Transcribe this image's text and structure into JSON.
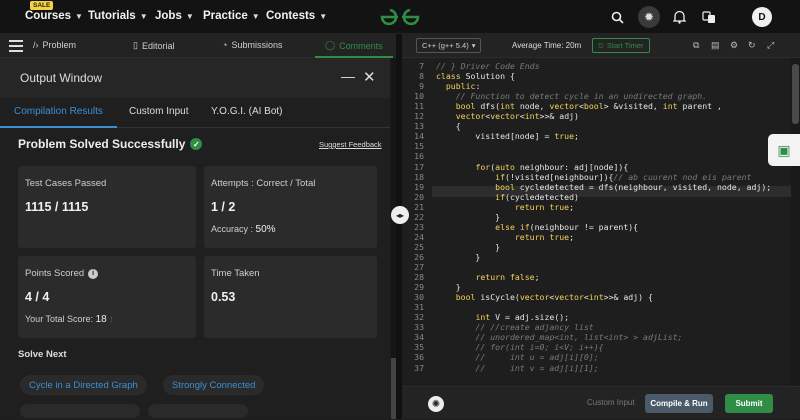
{
  "nav": {
    "sale_badge": "SALE",
    "items": [
      {
        "label": "Courses"
      },
      {
        "label": "Tutorials"
      },
      {
        "label": "Jobs"
      },
      {
        "label": "Practice"
      },
      {
        "label": "Contests"
      }
    ],
    "avatar_initial": "D",
    "brand_color": "#2f8d46"
  },
  "left_tabs": {
    "problem": "Problem",
    "editorial": "Editorial",
    "submissions": "Submissions",
    "comments": "Comments"
  },
  "output_window": {
    "title": "Output Window",
    "tabs": {
      "compilation": "Compilation Results",
      "custom_input": "Custom Input",
      "yogi": "Y.O.G.I. (AI Bot)"
    },
    "status": "Problem Solved Successfully",
    "suggest_feedback": "Suggest Feedback",
    "test_cases_label": "Test Cases Passed",
    "test_cases_value": "1115 / 1115",
    "attempts_label": "Attempts : Correct / Total",
    "attempts_value": "1 / 2",
    "accuracy_label": "Accuracy :",
    "accuracy_value": "50%",
    "points_label": "Points Scored",
    "points_value": "4 / 4",
    "total_score_label": "Your Total Score:",
    "total_score_value": "18",
    "time_label": "Time Taken",
    "time_value": "0.53",
    "solve_next": "Solve Next",
    "next_problems": [
      "Cycle in a Directed Graph",
      "Strongly Connected"
    ]
  },
  "editor": {
    "language": "C++ (g++ 5.4)",
    "avg_time": "Average Time: 20m",
    "start_timer": "Start Timer",
    "line_numbers": [
      "7",
      "8",
      "9",
      "10",
      "11",
      "12",
      "13",
      "14",
      "15",
      "16",
      "17",
      "18",
      "19",
      "20",
      "21",
      "22",
      "23",
      "24",
      "25",
      "26",
      "27",
      "28",
      "29",
      "30",
      "31",
      "32",
      "33",
      "34",
      "35",
      "36",
      "37"
    ],
    "code_lines": [
      "// } Driver Code Ends",
      "class Solution {",
      "  public:",
      "    // Function to detect cycle in an undirected graph.",
      "    bool dfs(int node, vector<bool> &visited, int parent ,",
      "    vector<vector<int>>& adj)",
      "    {",
      "        visited[node] = true;",
      "",
      "",
      "        for(auto neighbour: adj[node]){",
      "            if(!visited[neighbour]){// ab cuurent nod eis parent",
      "            bool cycledetected = dfs(neighbour, visited, node, adj);",
      "            if(cycledetected)",
      "                return true;",
      "            }",
      "            else if(neighbour != parent){",
      "                return true;",
      "            }",
      "        }",
      "",
      "        return false;",
      "    }",
      "    bool isCycle(vector<vector<int>>& adj) {",
      "",
      "        int V = adj.size();",
      "        // //create adjancy list",
      "        // unordered_map<int, list<int> > adjList;",
      "        // for(int i=0; i<V; i++){",
      "        //     int u = adj[i][0];",
      "        //     int v = adj[i][1];"
    ],
    "custom_input": "Custom Input",
    "compile_run": "Compile & Run",
    "submit": "Submit"
  }
}
